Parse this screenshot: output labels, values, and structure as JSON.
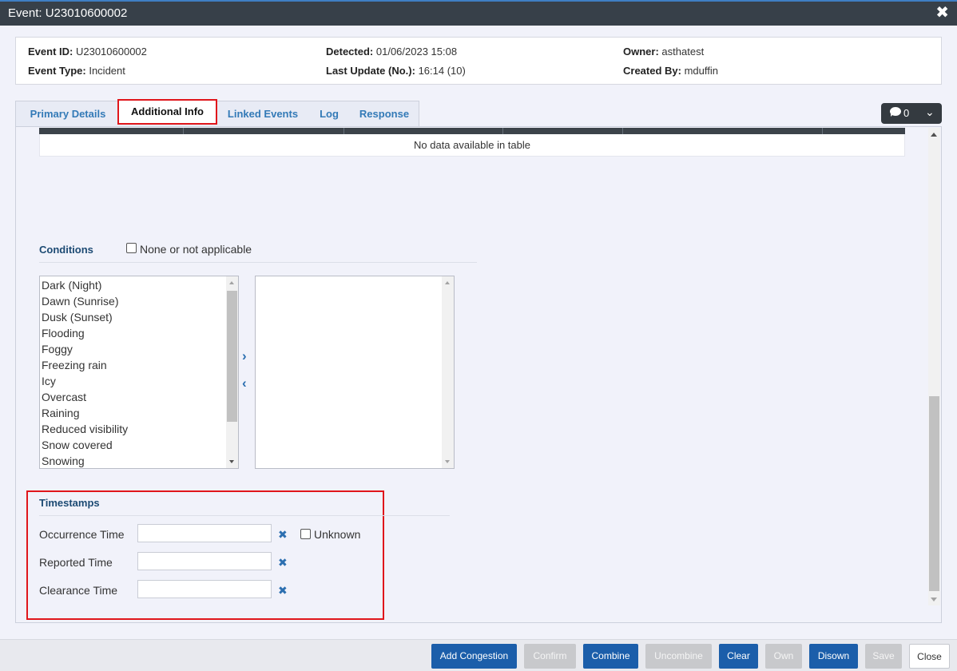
{
  "window": {
    "title": "Event: U23010600002"
  },
  "summary": {
    "event_id_label": "Event ID:",
    "event_id": "U23010600002",
    "event_type_label": "Event Type:",
    "event_type": "Incident",
    "detected_label": "Detected:",
    "detected": "01/06/2023 15:08",
    "last_update_label": "Last Update (No.):",
    "last_update": "16:14 (10)",
    "owner_label": "Owner:",
    "owner": "asthatest",
    "created_by_label": "Created By:",
    "created_by": "mduffin"
  },
  "tabs": [
    {
      "label": "Primary Details"
    },
    {
      "label": "Additional Info",
      "active": true
    },
    {
      "label": "Linked Events"
    },
    {
      "label": "Log"
    },
    {
      "label": "Response"
    }
  ],
  "comments": {
    "count": "0",
    "icon": "comment-icon"
  },
  "table": {
    "empty_text": "No data available in table"
  },
  "conditions": {
    "title": "Conditions",
    "none_label": "None or not applicable",
    "available": [
      "Dark (Night)",
      "Dawn (Sunrise)",
      "Dusk (Sunset)",
      "Flooding",
      "Foggy",
      "Freezing rain",
      "Icy",
      "Overcast",
      "Raining",
      "Reduced visibility",
      "Snow covered",
      "Snowing"
    ],
    "selected": [],
    "move_right_icon": "chevron-right-icon",
    "move_left_icon": "chevron-left-icon"
  },
  "timestamps": {
    "title": "Timestamps",
    "occurrence_label": "Occurrence Time",
    "occurrence_value": "",
    "unknown_label": "Unknown",
    "reported_label": "Reported Time",
    "reported_value": "",
    "clearance_label": "Clearance Time",
    "clearance_value": ""
  },
  "footer": {
    "add_congestion": "Add Congestion",
    "confirm": "Confirm",
    "combine": "Combine",
    "uncombine": "Uncombine",
    "clear": "Clear",
    "own": "Own",
    "disown": "Disown",
    "save": "Save",
    "close": "Close"
  },
  "colors": {
    "primary": "#1b5eaa",
    "highlight": "#e0161b",
    "titlebar": "#374049"
  }
}
